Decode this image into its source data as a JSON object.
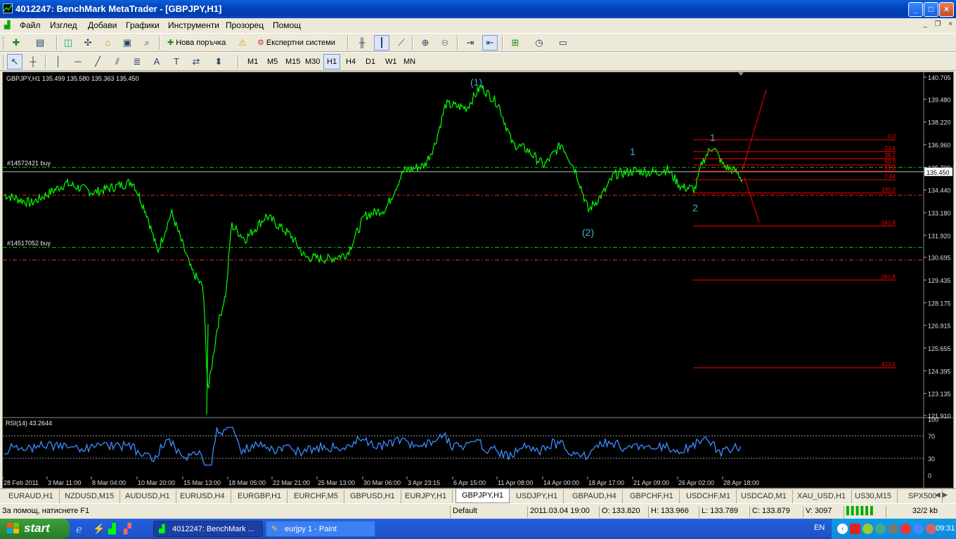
{
  "window": {
    "title": "4012247: BenchMark MetaTrader - [GBPJPY,H1]",
    "buttons": [
      "_",
      "□",
      "×"
    ]
  },
  "menu": {
    "items": [
      "Файл",
      "Изглед",
      "Добави",
      "Графики",
      "Инструменти",
      "Прозорец",
      "Помощ"
    ]
  },
  "toolbar1": {
    "new_order": "Нова поръчка",
    "experts": "Експертни системи"
  },
  "toolbar2": {
    "timeframes": [
      "M1",
      "M5",
      "M15",
      "M30",
      "H1",
      "H4",
      "D1",
      "W1",
      "MN"
    ],
    "active_timeframe": "H1"
  },
  "chart": {
    "info": "GBPJPY,H1  135.499 135.580 135.363 135.450",
    "current_price": "135.450",
    "price_ticks": [
      "140.705",
      "139.480",
      "138.220",
      "136.960",
      "135.700",
      "134.440",
      "133.180",
      "131.920",
      "130.695",
      "129.435",
      "128.175",
      "126.915",
      "125.655",
      "124.395",
      "123.135",
      "121.910"
    ],
    "time_ticks": [
      "28 Feb 2011",
      "3 Mar 11:00",
      "8 Mar 04:00",
      "10 Mar 20:00",
      "15 Mar 13:00",
      "18 Mar 05:00",
      "22 Mar 21:00",
      "25 Mar 13:00",
      "30 Mar 06:00",
      "3 Apr 23:15",
      "6 Apr 15:00",
      "11 Apr 08:00",
      "14 Apr 00:00",
      "18 Apr 17:00",
      "21 Apr 09:00",
      "26 Apr 02:00",
      "28 Apr 18:00"
    ],
    "order_labels": [
      "#14572421 buy",
      "#14517052 buy"
    ],
    "wave_labels": [
      "(1)",
      "(2)",
      "1",
      "2",
      "1"
    ],
    "fib_levels": [
      "0.0",
      "23.6",
      "38.2",
      "50.0",
      "61.8",
      "7.64",
      "100.0",
      "161.8",
      "261.8",
      "423.6"
    ],
    "colors": {
      "price": "#00FF00",
      "fib": "#FF0000",
      "rsi": "#3C8CFF",
      "wave": "#3FAFCF"
    }
  },
  "rsi": {
    "label": "RSI(14) 43.2644",
    "ticks": [
      "100",
      "70",
      "30",
      "0"
    ]
  },
  "tabs": {
    "items": [
      "EURAUD,H1",
      "NZDUSD,M15",
      "AUDUSD,H1",
      "EURUSD,H4",
      "EURGBP,H1",
      "EURCHF,M5",
      "GBPUSD,H1",
      "EURJPY,H1",
      "GBPJPY,H1",
      "USDJPY,H1",
      "GBPAUD,H4",
      "GBPCHF,H1",
      "USDCHF,M1",
      "USDCAD,M1",
      "XAU_USD,H1",
      "US30,M15",
      "SPX500"
    ],
    "active": "GBPJPY,H1"
  },
  "status": {
    "help": "За помощ, натиснете F1",
    "profile": "Default",
    "datetime": "2011.03.04 19:00",
    "open": "O: 133.820",
    "high": "H: 133.966",
    "low": "L: 133.789",
    "close": "C: 133.879",
    "volume": "V: 3097",
    "traffic": "32/2 kb"
  },
  "taskbar": {
    "start": "start",
    "tasks": [
      "4012247: BenchMark ...",
      "eurjpy 1 - Paint"
    ],
    "lang": "EN",
    "clock": "09:31"
  }
}
